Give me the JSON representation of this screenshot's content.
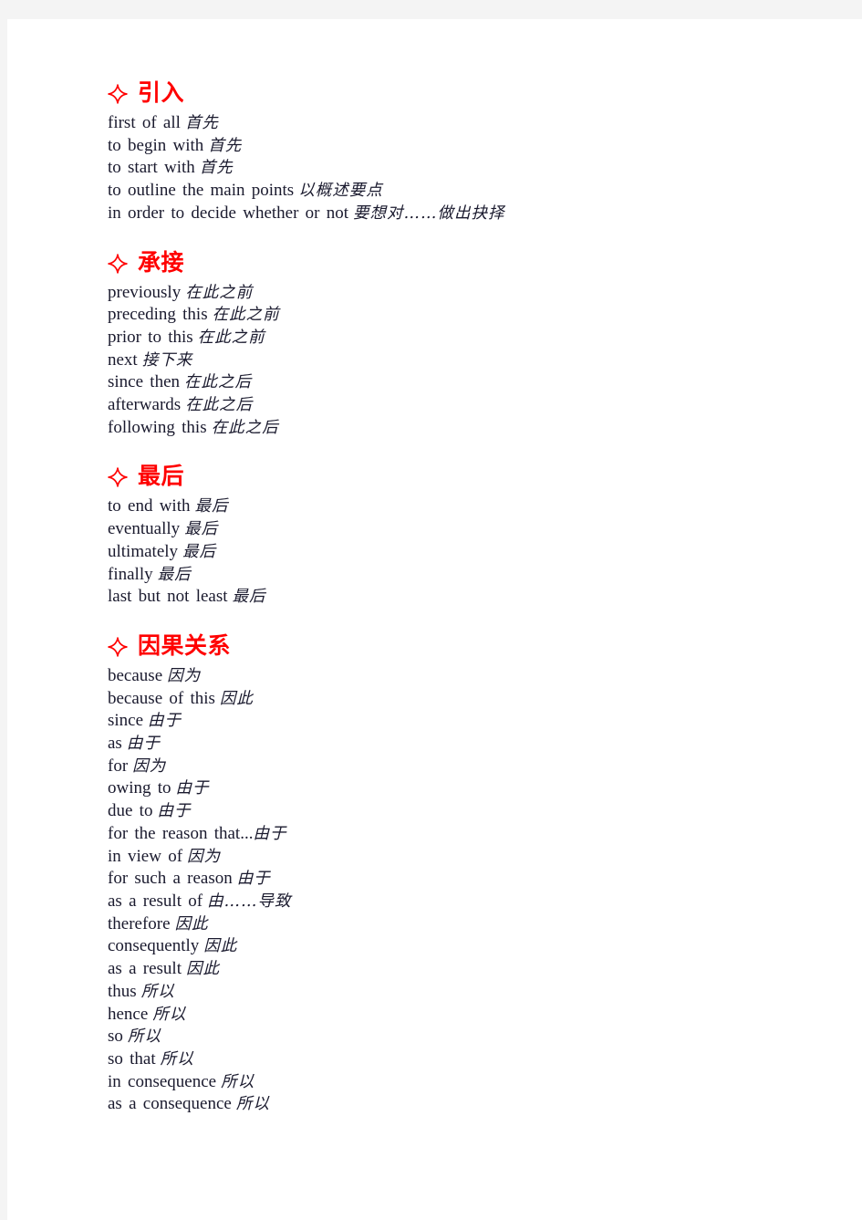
{
  "document": {
    "page_background": "#ffffff",
    "margin_background": "#f4f4f4",
    "heading_color": "#ff0000",
    "body_color": "#1a1a2e",
    "bullet_icon": "four-pointed-star-icon"
  },
  "sections": [
    {
      "title": "引入",
      "entries": [
        {
          "en": "first of all",
          "zh": "首先",
          "space": true
        },
        {
          "en": "to begin with",
          "zh": "首先",
          "space": true
        },
        {
          "en": "to start with",
          "zh": "首先",
          "space": true
        },
        {
          "en": "to outline the main points",
          "zh": "以概述要点",
          "space": true
        },
        {
          "en": "in order to decide whether or not",
          "zh": "要想对……做出抉择",
          "space": true
        }
      ]
    },
    {
      "title": "承接",
      "entries": [
        {
          "en": "previously",
          "zh": "在此之前",
          "space": true
        },
        {
          "en": "preceding this",
          "zh": "在此之前",
          "space": true
        },
        {
          "en": "prior to this",
          "zh": "在此之前",
          "space": true
        },
        {
          "en": "next",
          "zh": "接下来",
          "space": true
        },
        {
          "en": "since then",
          "zh": "在此之后",
          "space": true
        },
        {
          "en": "afterwards",
          "zh": "在此之后",
          "space": true
        },
        {
          "en": "following this",
          "zh": "在此之后",
          "space": true
        }
      ]
    },
    {
      "title": "最后",
      "entries": [
        {
          "en": "to end with",
          "zh": "最后",
          "space": true
        },
        {
          "en": "eventually",
          "zh": "最后",
          "space": true
        },
        {
          "en": "ultimately",
          "zh": "最后",
          "space": true
        },
        {
          "en": "finally",
          "zh": "最后",
          "space": true
        },
        {
          "en": "last but not least",
          "zh": "最后",
          "space": true
        }
      ]
    },
    {
      "title": "因果关系",
      "entries": [
        {
          "en": "because",
          "zh": "因为",
          "space": true
        },
        {
          "en": "because of this",
          "zh": "因此",
          "space": true
        },
        {
          "en": "since",
          "zh": "由于",
          "space": true
        },
        {
          "en": "as",
          "zh": "由于",
          "space": true
        },
        {
          "en": "for",
          "zh": "因为",
          "space": true
        },
        {
          "en": "owing to",
          "zh": "由于",
          "space": true
        },
        {
          "en": "due to",
          "zh": "由于",
          "space": true
        },
        {
          "en": "for the reason that...",
          "zh": "由于",
          "space": false
        },
        {
          "en": "in view of",
          "zh": "因为",
          "space": true
        },
        {
          "en": "for such a reason",
          "zh": "由于",
          "space": true
        },
        {
          "en": "as a result of",
          "zh": "由……导致",
          "space": true
        },
        {
          "en": "therefore",
          "zh": "因此",
          "space": true
        },
        {
          "en": "consequently",
          "zh": "因此",
          "space": true
        },
        {
          "en": "as a result",
          "zh": "因此",
          "space": true
        },
        {
          "en": "thus",
          "zh": "所以",
          "space": true
        },
        {
          "en": "hence",
          "zh": "所以",
          "space": true
        },
        {
          "en": "so",
          "zh": "所以",
          "space": true
        },
        {
          "en": "so that",
          "zh": "所以",
          "space": true
        },
        {
          "en": "in consequence",
          "zh": "所以",
          "space": true
        },
        {
          "en": "as a consequence",
          "zh": "所以",
          "space": true
        }
      ]
    }
  ]
}
